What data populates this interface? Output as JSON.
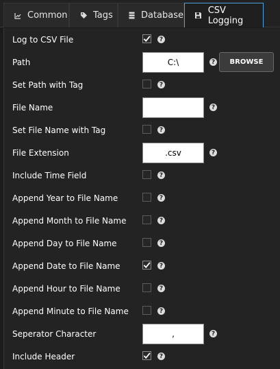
{
  "tabs": [
    {
      "label": "Common",
      "icon": "chart-icon"
    },
    {
      "label": "Tags",
      "icon": "tag-icon"
    },
    {
      "label": "Database",
      "icon": "database-icon"
    },
    {
      "label": "CSV Logging",
      "icon": "save-icon"
    }
  ],
  "active_tab": "CSV Logging",
  "help_glyph": "?",
  "colors": {
    "accent": "#4aa3df",
    "panel": "#232323",
    "background": "#1b1b1b"
  },
  "fields": {
    "log_to_csv": {
      "label": "Log to CSV File",
      "checked": true
    },
    "path": {
      "label": "Path",
      "value": "C:\\",
      "browse_label": "BROWSE"
    },
    "set_path_with_tag": {
      "label": "Set Path with Tag",
      "checked": false
    },
    "file_name": {
      "label": "File Name",
      "value": ""
    },
    "set_file_name_with_tag": {
      "label": "Set File Name with Tag",
      "checked": false
    },
    "file_extension": {
      "label": "File Extension",
      "value": ".csv"
    },
    "include_time_field": {
      "label": "Include Time Field",
      "checked": false
    },
    "append_year": {
      "label": "Append Year to File Name",
      "checked": false
    },
    "append_month": {
      "label": "Append Month to File Name",
      "checked": false
    },
    "append_day": {
      "label": "Append Day to File Name",
      "checked": false
    },
    "append_date": {
      "label": "Append Date to File Name",
      "checked": true
    },
    "append_hour": {
      "label": "Append Hour to File Name",
      "checked": false
    },
    "append_minute": {
      "label": "Append Minute to File Name",
      "checked": false
    },
    "separator_character": {
      "label": "Seperator Character",
      "value": ","
    },
    "include_header": {
      "label": "Include Header",
      "checked": true
    }
  }
}
